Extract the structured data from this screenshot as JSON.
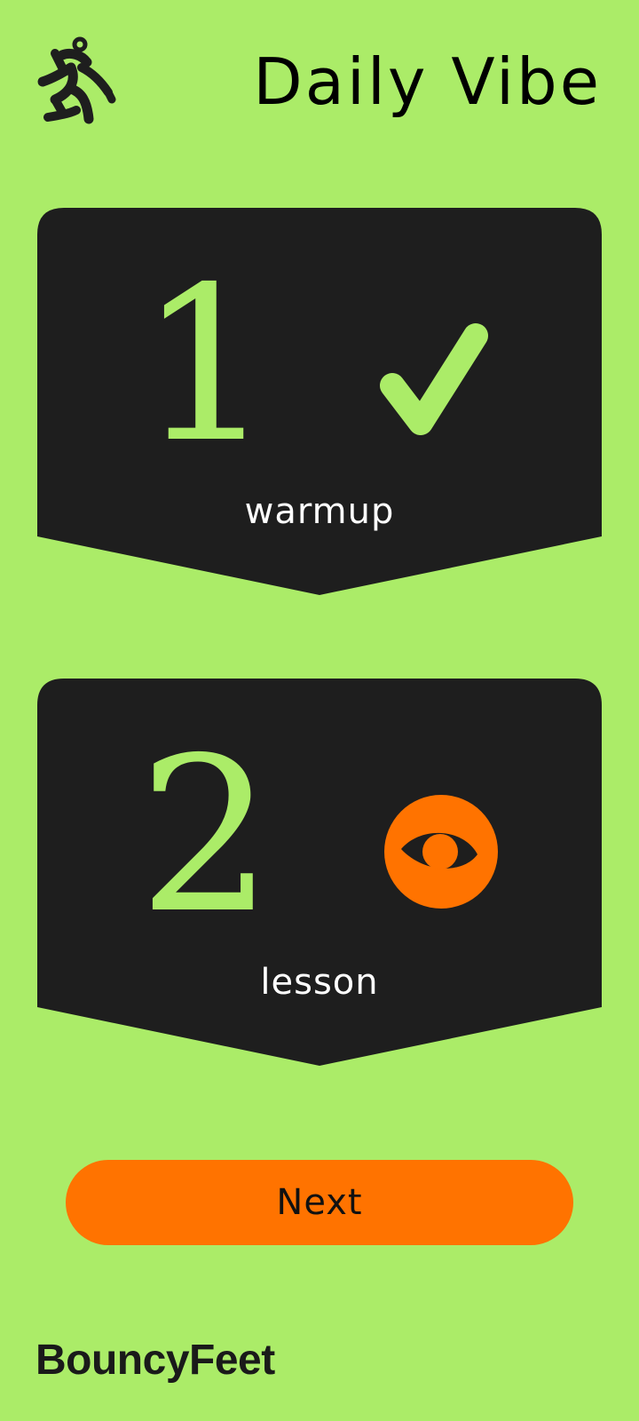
{
  "header": {
    "logo_icon": "dancing-figure-icon",
    "title": "Daily Vibe"
  },
  "steps": [
    {
      "number": "1",
      "label": "warmup",
      "status": "completed",
      "status_icon": "checkmark-icon"
    },
    {
      "number": "2",
      "label": "lesson",
      "status": "viewing",
      "status_icon": "eye-icon"
    }
  ],
  "actions": {
    "next_label": "Next"
  },
  "footer": {
    "brand": "BouncyFeet"
  },
  "colors": {
    "background": "#abec68",
    "card": "#1e1e1e",
    "accent_green": "#abec68",
    "accent_orange": "#ff7300",
    "text_dark": "#000000",
    "text_light": "#ffffff"
  }
}
